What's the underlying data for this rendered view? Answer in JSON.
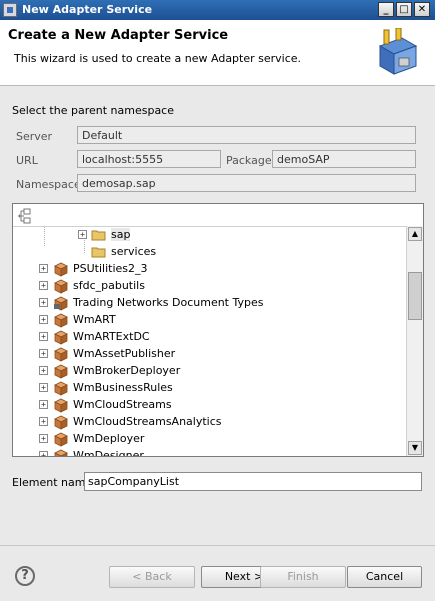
{
  "window": {
    "title": "New Adapter Service"
  },
  "header": {
    "title": "Create a New Adapter Service",
    "description": "This wizard is used to create a new Adapter service."
  },
  "namespace": {
    "section_label": "Select the parent namespace",
    "server_label": "Server",
    "server_value": "Default",
    "url_label": "URL",
    "url_value": "localhost:5555",
    "package_label": "Package",
    "package_value": "demoSAP",
    "namespace_label": "Namespace",
    "namespace_value": "demosap.sap"
  },
  "tree": {
    "nodes": [
      {
        "label": "sap",
        "type": "folder",
        "expander": "+",
        "selected": true
      },
      {
        "label": "services",
        "type": "folder",
        "expander": ""
      },
      {
        "label": "PSUtilities2_3",
        "type": "package",
        "expander": "+"
      },
      {
        "label": "sfdc_pabutils",
        "type": "package",
        "expander": "+"
      },
      {
        "label": "Trading Networks Document Types",
        "type": "package-locked",
        "expander": "+"
      },
      {
        "label": "WmART",
        "type": "package",
        "expander": "+"
      },
      {
        "label": "WmARTExtDC",
        "type": "package",
        "expander": "+"
      },
      {
        "label": "WmAssetPublisher",
        "type": "package",
        "expander": "+"
      },
      {
        "label": "WmBrokerDeployer",
        "type": "package",
        "expander": "+"
      },
      {
        "label": "WmBusinessRules",
        "type": "package",
        "expander": "+"
      },
      {
        "label": "WmCloudStreams",
        "type": "package",
        "expander": "+"
      },
      {
        "label": "WmCloudStreamsAnalytics",
        "type": "package",
        "expander": "+"
      },
      {
        "label": "WmDeployer",
        "type": "package",
        "expander": "+"
      },
      {
        "label": "WmDesigner",
        "type": "package",
        "expander": "+"
      }
    ]
  },
  "element": {
    "label": "Element name",
    "value": "sapCompanyList"
  },
  "buttons": {
    "back": "< Back",
    "next": "Next >",
    "finish": "Finish",
    "cancel": "Cancel",
    "help": "?"
  },
  "colors": {
    "title_bar": "#1d4f93",
    "package_icon": "#c8773a",
    "folder_icon": "#e8c46a"
  }
}
